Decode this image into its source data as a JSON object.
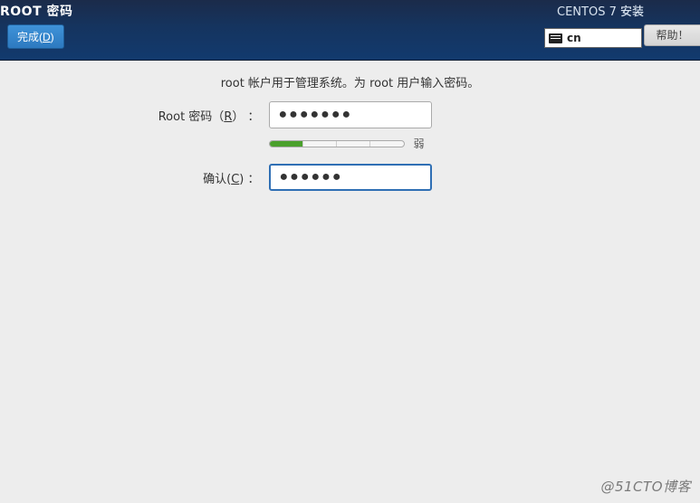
{
  "header": {
    "title_left": "ROOT 密码",
    "title_right": "CENTOS 7 安装",
    "done_prefix": "完成(",
    "done_key": "D",
    "done_suffix": ")",
    "lang": "cn",
    "help": "帮助！"
  },
  "content": {
    "instruction": "root 帐户用于管理系统。为 root 用户输入密码。",
    "root_label_prefix": "Root 密码（",
    "root_label_key": "R",
    "root_label_suffix": "） ：",
    "root_value": "●●●●●●●",
    "strength_text": "弱",
    "confirm_prefix": "确认(",
    "confirm_key": "C",
    "confirm_suffix": ") ：",
    "confirm_value": "●●●●●●"
  },
  "watermark": "@51CTO博客"
}
